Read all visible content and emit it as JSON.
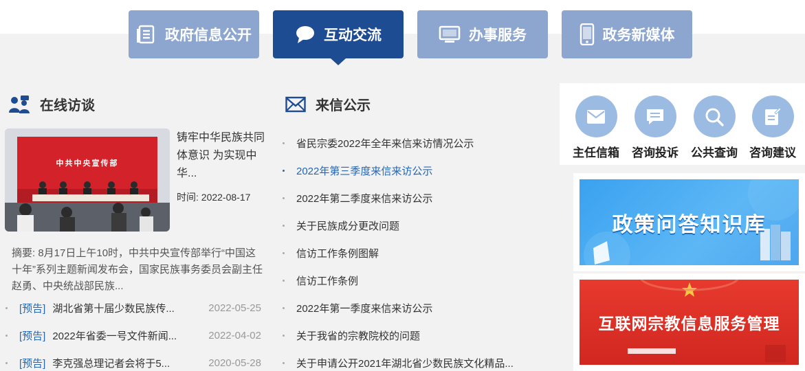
{
  "tabs": [
    {
      "label": "政府信息公开",
      "icon": "document-list-icon",
      "active": false
    },
    {
      "label": "互动交流",
      "icon": "chat-bubble-icon",
      "active": true
    },
    {
      "label": "办事服务",
      "icon": "monitor-icon",
      "active": false
    },
    {
      "label": "政务新媒体",
      "icon": "mobile-phone-icon",
      "active": false
    }
  ],
  "interview": {
    "title": "在线访谈",
    "icon": "people-chat-icon",
    "featured_title": "铸牢中华民族共同体意识 为实现中华...",
    "featured_date": "时间: 2022-08-17",
    "photo_banner_text": "中共中央宣传部",
    "summary": "摘要: 8月17日上午10时，中共中央宣传部举行“中国这十年”系列主题新闻发布会，国家民族事务委员会副主任赵勇、中央统战部民族...",
    "notices": [
      {
        "tag": "[预告]",
        "text": "湖北省第十届少数民族传...",
        "date": "2022-05-25"
      },
      {
        "tag": "[预告]",
        "text": "2022年省委一号文件新闻...",
        "date": "2022-04-02"
      },
      {
        "tag": "[预告]",
        "text": "李克强总理记者会将于5...",
        "date": "2020-05-28"
      }
    ]
  },
  "letters": {
    "title": "来信公示",
    "icon": "envelope-icon",
    "items": [
      "省民宗委2022年全年来信来访情况公示",
      "2022年第三季度来信来访公示",
      "2022年第二季度来信来访公示",
      "关于民族成分更改问题",
      "信访工作条例图解",
      "信访工作条例",
      "2022年第一季度来信来访公示",
      "关于我省的宗教院校的问题",
      "关于申请公开2021年湖北省少数民族文化精品..."
    ]
  },
  "services": [
    {
      "label": "主任信箱",
      "icon": "mail-icon"
    },
    {
      "label": "咨询投诉",
      "icon": "message-list-icon"
    },
    {
      "label": "公共查询",
      "icon": "search-icon"
    },
    {
      "label": "咨询建议",
      "icon": "edit-note-icon"
    }
  ],
  "banners": [
    {
      "text": "政策问答知识库"
    },
    {
      "text": "互联网宗教信息服务管理"
    }
  ],
  "colors": {
    "active_tab": "#1e4c93",
    "inactive_tab": "#8da6cf",
    "link_blue": "#2566b0",
    "service_circle": "#9bbbe3"
  }
}
